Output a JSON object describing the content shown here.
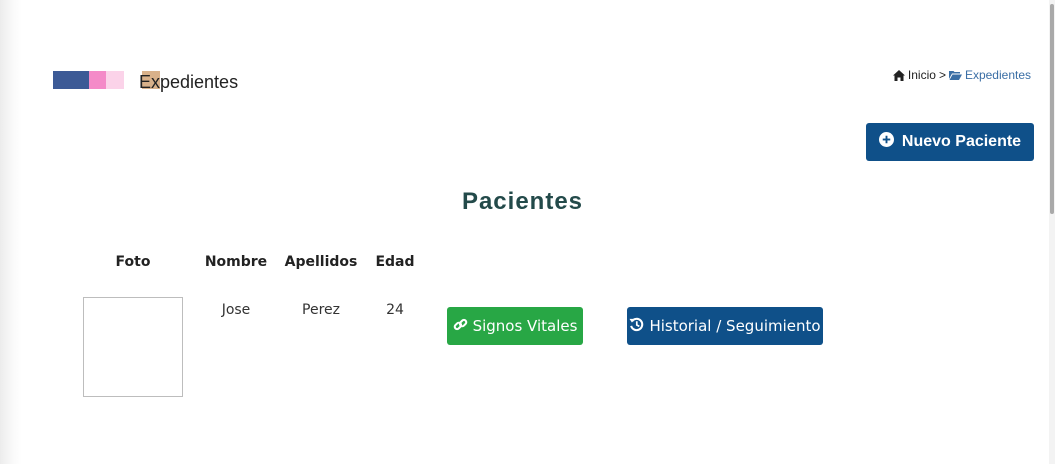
{
  "header": {
    "title": "Expedientes"
  },
  "breadcrumb": {
    "home_label": "Inicio",
    "separator": ">",
    "current_label": "Expedientes"
  },
  "actions": {
    "new_patient_label": "Nuevo Paciente"
  },
  "section": {
    "title": "Pacientes"
  },
  "table": {
    "columns": [
      "Foto",
      "Nombre",
      "Apellidos",
      "Edad"
    ],
    "rows": [
      {
        "nombre": "Jose",
        "apellidos": "Perez",
        "edad": "24",
        "signos_label": "Signos Vitales",
        "historial_label": "Historial / Seguimiento"
      }
    ]
  },
  "icons": {
    "home": "home-icon",
    "folder": "folder-open-icon",
    "plus": "plus-circle-icon",
    "link": "link-icon",
    "history": "history-icon"
  },
  "colors": {
    "primary": "#0f5089",
    "success": "#28a745",
    "title": "#234a4a",
    "link": "#3a6ea5"
  }
}
